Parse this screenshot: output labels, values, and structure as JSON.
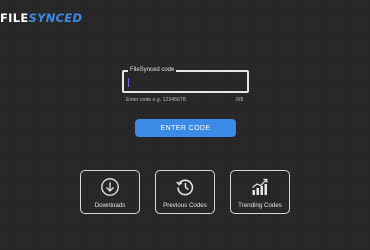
{
  "app": {
    "logo_part1": "FILE",
    "logo_part2": "SYNCED"
  },
  "code_entry": {
    "field_label": "FileSynced code",
    "input_value": "",
    "helper_text": "Enter code e.g. 12345678",
    "char_counter": "0/8",
    "submit_label": "ENTER CODE"
  },
  "shortcuts": [
    {
      "label": "Downloads",
      "icon": "download-circle-icon"
    },
    {
      "label": "Previous Codes",
      "icon": "history-icon"
    },
    {
      "label": "Trending Codes",
      "icon": "trending-chart-icon"
    }
  ],
  "colors": {
    "background": "#262626",
    "accent": "#3a8ae6",
    "logo_accent": "#3f8ae4",
    "caret": "#7a5fe0"
  }
}
